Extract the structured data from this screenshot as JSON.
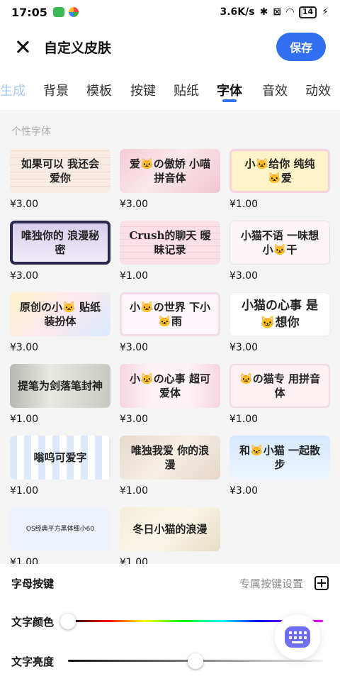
{
  "status_bar": {
    "time": "17:05",
    "network_speed": "3.6K/s",
    "battery": "14"
  },
  "header": {
    "title": "自定义皮肤",
    "save_label": "保存"
  },
  "tabs": [
    {
      "label": "生成"
    },
    {
      "label": "背景"
    },
    {
      "label": "模板"
    },
    {
      "label": "按键"
    },
    {
      "label": "贴纸"
    },
    {
      "label": "字体",
      "active": true
    },
    {
      "label": "音效"
    },
    {
      "label": "动效"
    }
  ],
  "section_title": "个性字体",
  "fonts": [
    {
      "preview": "如果可以 我还会爱你",
      "price": "¥3.00"
    },
    {
      "preview": "爱🐱の傲娇 小喵拼音体",
      "price": "¥3.00"
    },
    {
      "preview": "小🐱给你 纯纯🐱爱",
      "price": "¥1.00"
    },
    {
      "preview": "唯独你的 浪漫秘密",
      "price": "¥3.00"
    },
    {
      "preview": "Crush的聊天 暧昧记录",
      "price": "¥1.00"
    },
    {
      "preview": "小猫不语 一味想小🐱干",
      "price": "¥3.00"
    },
    {
      "preview": "原创の小🐱 贴纸装扮体",
      "price": "¥3.00"
    },
    {
      "preview": "小🐱の世界 下小🐱雨",
      "price": "¥3.00"
    },
    {
      "preview": "小猫の心事 是🐱想你",
      "price": "¥3.00"
    },
    {
      "preview": "提笔为剑落笔封神",
      "price": "¥1.00"
    },
    {
      "preview": "小🐱の心事 超可爱体",
      "price": "¥3.00"
    },
    {
      "preview": "🐱の猫专 用拼音体",
      "price": "¥1.00"
    },
    {
      "preview": "嗡呜可爱字",
      "price": "¥1.00"
    },
    {
      "preview": "唯独我爱 你的浪漫",
      "price": "¥1.00"
    },
    {
      "preview": "和🐱小猫 一起散步",
      "price": "¥3.00"
    },
    {
      "preview": "OS经典平方黑体细小60",
      "price": "¥1.00"
    },
    {
      "preview": "冬日小猫的浪漫",
      "price": "¥1.00"
    }
  ],
  "letter_keys": {
    "label": "字母按键",
    "settings_label": "专属按键设置"
  },
  "text_color": {
    "label": "文字颜色",
    "value": 0
  },
  "text_brightness": {
    "label": "文字亮度",
    "value": 0.5
  },
  "colors": {
    "accent": "#2f6ff0",
    "fab": "#6d6ef0"
  }
}
